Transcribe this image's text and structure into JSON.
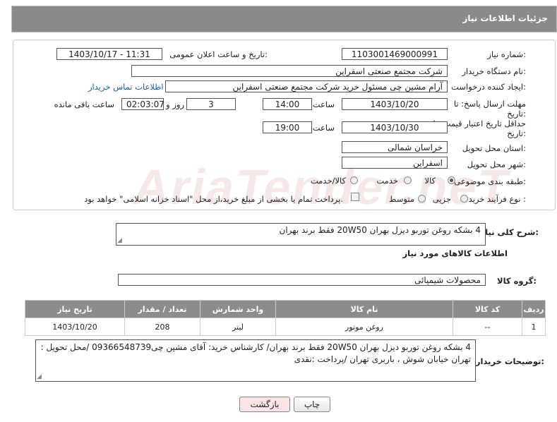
{
  "header": {
    "title": "جزئیات اطلاعات نیاز"
  },
  "form": {
    "need_number_label": "شماره نیاز:",
    "need_number": "1103001469000991",
    "announce_label": "تاریخ و ساعت اعلان عمومی:",
    "announce_value": "1403/10/17 - 11:31",
    "buyer_org_label": "نام دستگاه خریدار:",
    "buyer_org": "شرکت مجتمع صنعتی اسفراین",
    "creator_label": "ایجاد کننده درخواست:",
    "creator": "آرام مشین چی مسئول خرید شرکت مجتمع صنعتی اسفراین",
    "contact_link": "اطلاعات تماس خریدار",
    "deadline_label": "مهلت ارسال پاسخ: تا",
    "deadline_label2": "تاریخ:",
    "deadline_date": "1403/10/20",
    "time_label": "ساعت",
    "deadline_time": "14:00",
    "days_value": "3",
    "days_label": "روز و",
    "remaining_time": "02:03:07",
    "remaining_label": "ساعت باقی مانده",
    "price_valid_label": "حداقل تاریخ اعتبار قیمت: تا",
    "price_valid_label2": "تاریخ:",
    "price_valid_date": "1403/10/30",
    "price_valid_time": "19:00",
    "province_label": "استان محل تحویل:",
    "province": "خراسان شمالی",
    "city_label": "شهر محل تحویل:",
    "city": "اسفراین",
    "category_label": "طبقه بندی موضوعی:",
    "category_options": [
      "کالا",
      "خدمت",
      "کالا/خدمت"
    ],
    "process_label": "نوع فرآیند خرید :",
    "process_options": [
      "جزیی",
      "متوسط"
    ],
    "payment_note": "پرداخت تمام یا بخشی از مبلغ خرید،از محل \"اسناد خزانه اسلامی\" خواهد بود."
  },
  "description": {
    "label": "شرح کلی نیاز:",
    "value": "4 بشکه روغن توربو دیزل بهران 20W50 فقط برند بهران"
  },
  "goods": {
    "section_title": "اطلاعات کالاهای مورد نیاز",
    "group_label": "گروه کالا:",
    "group_value": "محصولات شیمیائی",
    "columns": [
      "ردیف",
      "کد کالا",
      "نام کالا",
      "واحد شمارش",
      "تعداد / مقدار",
      "تاریخ نیاز"
    ],
    "rows": [
      {
        "row": "1",
        "code": "--",
        "name": "روغن موتور",
        "unit": "لیتر",
        "qty": "208",
        "date": "1403/10/20"
      }
    ]
  },
  "buyer_notes": {
    "label": "توضیحات خریدار:",
    "value": "4 بشکه روغن توربو دیزل بهران 20W50 فقط برند بهران/ کارشناس خرید: آقای مشین چی09366548739 /محل تحویل : تهران خیابان شوش ، باربری تهران /پرداخت :نقدی"
  },
  "buttons": {
    "print": "چاپ",
    "back": "بازگشت"
  },
  "watermark": "AriaTender.neT"
}
